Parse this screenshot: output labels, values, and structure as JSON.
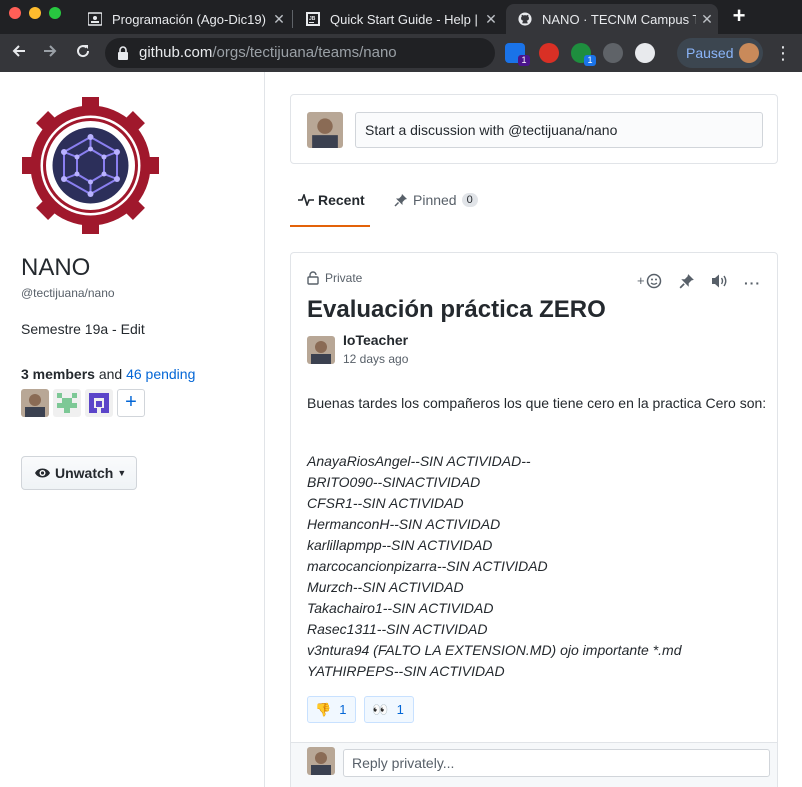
{
  "browser": {
    "tabs": [
      {
        "title": "Programación (Ago-Dic19)",
        "active": false
      },
      {
        "title": "Quick Start Guide - Help |",
        "active": false
      },
      {
        "title": "NANO · TECNM Campus Ti",
        "active": true
      }
    ],
    "url_host": "github.com",
    "url_path": "/orgs/tectijuana/teams/nano",
    "extensions": [
      {
        "icon": "blue-extension-icon",
        "badge": "1"
      },
      {
        "icon": "red-hand-extension-icon",
        "badge": ""
      },
      {
        "icon": "green-extension-icon",
        "badge": "1"
      },
      {
        "icon": "gray-extension-icon",
        "badge": ""
      },
      {
        "icon": "white-extension-icon",
        "badge": ""
      }
    ],
    "profile_status": "Paused"
  },
  "team": {
    "name": "NANO",
    "handle": "@tectijuana/nano",
    "description": "Semestre 19a - Edit",
    "members_count": "3 members",
    "members_and": "and",
    "pending_link": "46 pending",
    "watch_label": "Unwatch"
  },
  "discussion_box": {
    "placeholder": "Start a discussion with @tectijuana/nano"
  },
  "tabs": {
    "recent": "Recent",
    "pinned": "Pinned",
    "pinned_count": "0"
  },
  "post": {
    "visibility": "Private",
    "title": "Evaluación práctica ZERO",
    "author": "IoTeacher",
    "time": "12 days ago",
    "body": "Buenas tardes los compañeros los que tiene cero en la practica Cero son:",
    "list": [
      "AnayaRiosAngel--SIN ACTIVIDAD--",
      "BRITO090--SINACTIVIDAD",
      "CFSR1--SIN ACTIVIDAD",
      "HermanconH--SIN ACTIVIDAD",
      "karlillapmpp--SIN ACTIVIDAD",
      "marcocancionpizarra--SIN ACTIVIDAD",
      "Murzch--SIN ACTIVIDAD",
      "Takachairo1--SIN ACTIVIDAD",
      "Rasec1311--SIN ACTIVIDAD",
      "v3ntura94 (FALTO LA EXTENSION.MD) ojo importante *.md",
      "YATHIRPEPS--SIN ACTIVIDAD"
    ],
    "reactions": [
      {
        "emoji": "👎",
        "count": "1"
      },
      {
        "emoji": "👀",
        "count": "1"
      }
    ],
    "reply_placeholder": "Reply privately..."
  },
  "colors": {
    "chrome_dark": "#202124",
    "chrome_toolbar": "#35363a",
    "link": "#0366d6",
    "tab_underline": "#e36209",
    "logo_red": "#a0182c",
    "logo_purple": "#6a5cc8"
  }
}
